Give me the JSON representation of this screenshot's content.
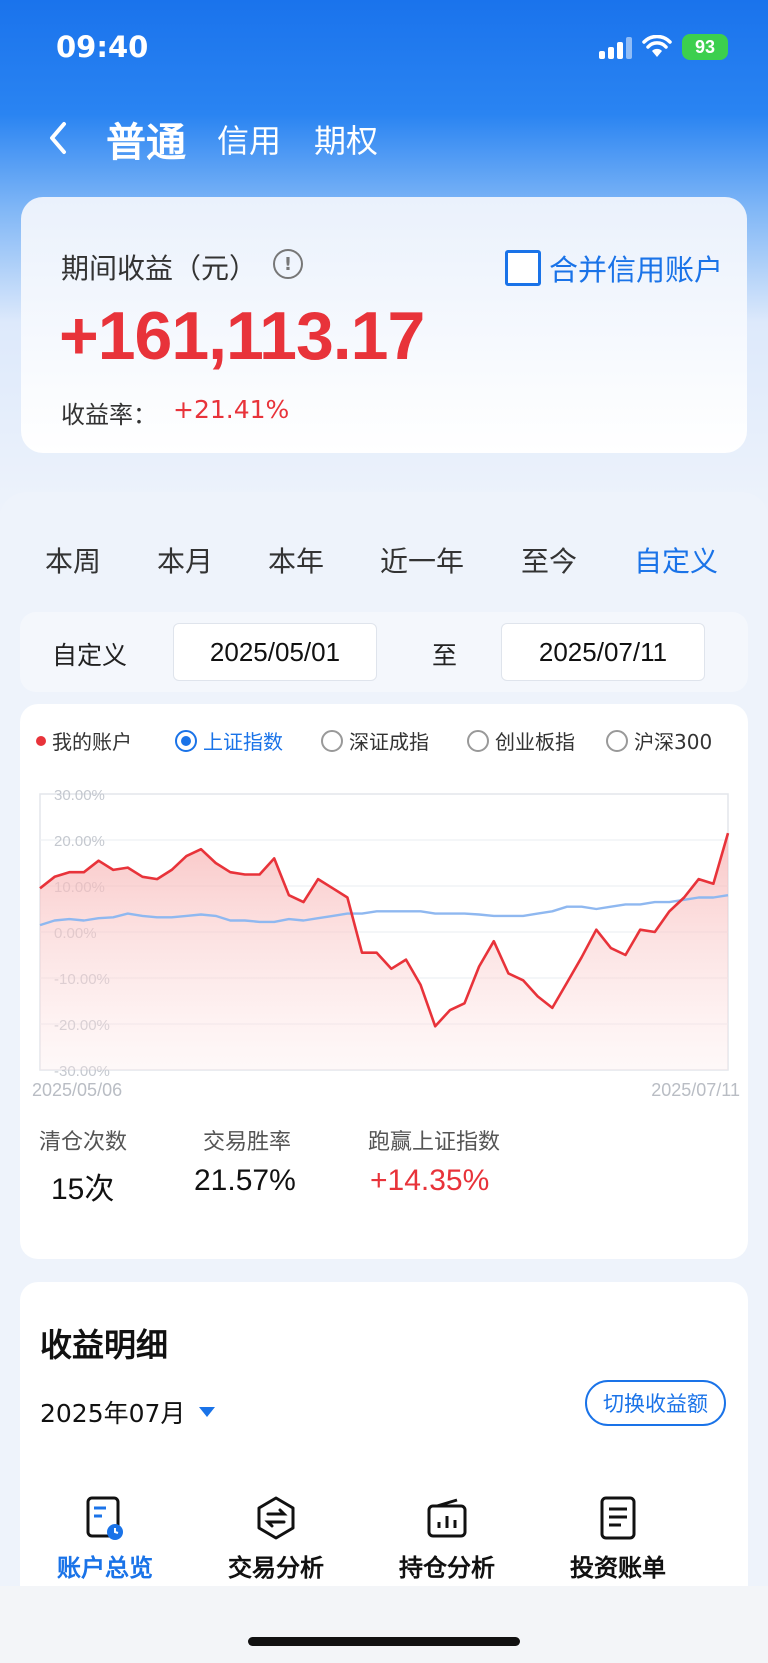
{
  "status": {
    "time": "09:40",
    "battery": "93"
  },
  "nav": {
    "tabs": [
      "普通",
      "信用",
      "期权"
    ],
    "active": 0
  },
  "summary": {
    "label": "期间收益（元）",
    "merge_label": "合并信用账户",
    "profit": "+161,113.17",
    "rate_label": "收益率：",
    "rate_value": "+21.41%"
  },
  "periods": {
    "items": [
      "本周",
      "本月",
      "本年",
      "近一年",
      "至今",
      "自定义"
    ],
    "active": 5
  },
  "custom": {
    "label": "自定义",
    "start": "2025/05/01",
    "to": "至",
    "end": "2025/07/11"
  },
  "legend": {
    "mine": "我的账户",
    "indices": [
      "上证指数",
      "深证成指",
      "创业板指",
      "沪深300"
    ],
    "selected": 0
  },
  "chart_data": {
    "type": "line",
    "x_start": "2025/05/06",
    "x_end": "2025/07/11",
    "ylim": [
      -30,
      30
    ],
    "yticks": [
      "30.00%",
      "20.00%",
      "10.00%",
      "0.00%",
      "-10.00%",
      "-20.00%",
      "-30.00%"
    ],
    "series": [
      {
        "name": "我的账户",
        "color": "#e8333a",
        "values": [
          9.5,
          12,
          13,
          13,
          15.5,
          13.5,
          14,
          12,
          11.5,
          13.5,
          16.5,
          18,
          15,
          13,
          12.5,
          12.5,
          16,
          8,
          6.5,
          11.5,
          9.5,
          7.5,
          -4.5,
          -4.5,
          -8,
          -6,
          -11.5,
          -20.5,
          -17,
          -15.5,
          -7.5,
          -2,
          -9,
          -10.5,
          -14,
          -16.5,
          -11,
          -5.5,
          0.5,
          -3.5,
          -5,
          0.5,
          0,
          4.5,
          7.5,
          11.5,
          10.5,
          21.5
        ]
      },
      {
        "name": "上证指数",
        "color": "#8fb8f0",
        "values": [
          1.5,
          2.5,
          2.8,
          2.5,
          3,
          3.2,
          4,
          3.5,
          3.2,
          3.2,
          3.5,
          3.8,
          3.5,
          2.5,
          2.5,
          2.2,
          2.2,
          2.8,
          2.5,
          3,
          3.5,
          4,
          4,
          4.5,
          4.5,
          4.5,
          4.5,
          4,
          4,
          4,
          3.8,
          3.5,
          3.5,
          3.5,
          4,
          4.5,
          5.5,
          5.5,
          5,
          5.5,
          6,
          6,
          6.5,
          6.5,
          7,
          7.5,
          7.5,
          8
        ]
      }
    ]
  },
  "stats": [
    {
      "label": "清仓次数",
      "value": "15次"
    },
    {
      "label": "交易胜率",
      "value": "21.57%"
    },
    {
      "label": "跑赢上证指数",
      "value": "+14.35%"
    }
  ],
  "detail": {
    "title": "收益明细",
    "month": "2025年07月",
    "switch_label": "切换收益额"
  },
  "bottom_nav": {
    "items": [
      "账户总览",
      "交易分析",
      "持仓分析",
      "投资账单"
    ],
    "active": 0
  }
}
